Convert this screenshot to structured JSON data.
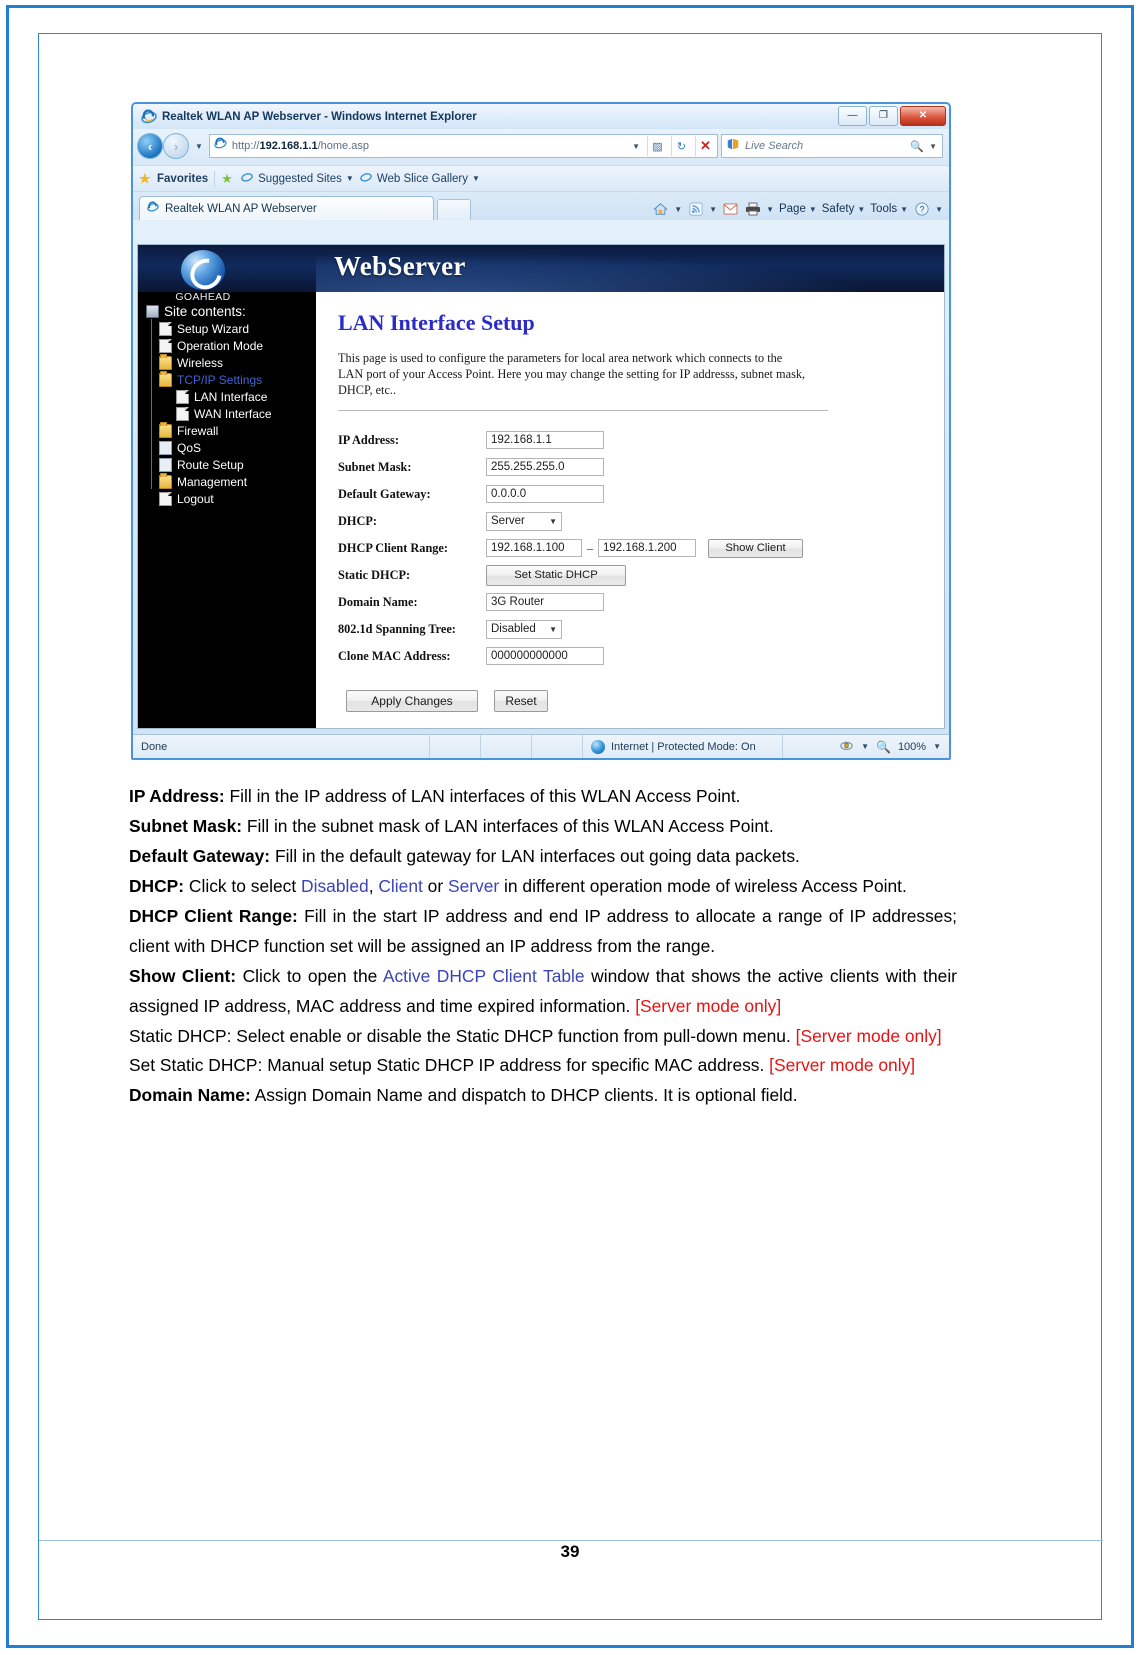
{
  "browser": {
    "title": "Realtek WLAN AP Webserver - Windows Internet Explorer",
    "window_buttons": {
      "minimize": "—",
      "maximize": "❐",
      "close": "✕"
    },
    "address": {
      "protocol": "http://",
      "host": "192.168.1.1",
      "path": "/home.asp"
    },
    "search": {
      "placeholder": "Live Search",
      "value": "Live Search"
    },
    "favorites_bar": {
      "favorites": "Favorites",
      "suggested_sites": "Suggested Sites",
      "web_slice_gallery": "Web Slice Gallery"
    },
    "tab": {
      "label": "Realtek WLAN AP Webserver"
    },
    "command_bar": {
      "page": "Page",
      "safety": "Safety",
      "tools": "Tools"
    },
    "status": {
      "done": "Done",
      "zone": "Internet | Protected Mode: On",
      "zoom": "100%"
    }
  },
  "webserver": {
    "brand": {
      "name": "GOAHEAD",
      "title": "WebServer"
    },
    "tree": {
      "root": "Site contents:",
      "items": [
        {
          "label": "Setup Wizard",
          "icon": "doc",
          "level": 1,
          "active": false
        },
        {
          "label": "Operation Mode",
          "icon": "doc",
          "level": 1,
          "active": false
        },
        {
          "label": "Wireless",
          "icon": "folder",
          "level": 1,
          "active": false
        },
        {
          "label": "TCP/IP Settings",
          "icon": "folder-open",
          "level": 1,
          "active": true
        },
        {
          "label": "LAN Interface",
          "icon": "doc",
          "level": 2,
          "active": false
        },
        {
          "label": "WAN Interface",
          "icon": "doc",
          "level": 2,
          "active": false
        },
        {
          "label": "Firewall",
          "icon": "folder",
          "level": 1,
          "active": false
        },
        {
          "label": "QoS",
          "icon": "book",
          "level": 1,
          "active": false
        },
        {
          "label": "Route Setup",
          "icon": "book",
          "level": 1,
          "active": false
        },
        {
          "label": "Management",
          "icon": "folder",
          "level": 1,
          "active": false
        },
        {
          "label": "Logout",
          "icon": "doc",
          "level": 1,
          "active": false
        }
      ]
    },
    "page": {
      "title": "LAN Interface Setup",
      "description": "This page is used to configure the parameters for local area network which connects to the LAN port of your Access Point. Here you may change the setting for IP addresss, subnet mask, DHCP, etc..",
      "fields": {
        "ip_address_label": "IP Address:",
        "ip_address_value": "192.168.1.1",
        "subnet_mask_label": "Subnet Mask:",
        "subnet_mask_value": "255.255.255.0",
        "default_gateway_label": "Default Gateway:",
        "default_gateway_value": "0.0.0.0",
        "dhcp_label": "DHCP:",
        "dhcp_value": "Server",
        "dhcp_range_label": "DHCP Client Range:",
        "dhcp_range_start": "192.168.1.100",
        "dhcp_range_sep": "–",
        "dhcp_range_end": "192.168.1.200",
        "show_client_button": "Show Client",
        "static_dhcp_label": "Static DHCP:",
        "set_static_dhcp_button": "Set Static DHCP",
        "domain_name_label": "Domain Name:",
        "domain_name_value": "3G Router",
        "spanning_tree_label": "802.1d Spanning Tree:",
        "spanning_tree_value": "Disabled",
        "clone_mac_label": "Clone MAC Address:",
        "clone_mac_value": "000000000000"
      },
      "buttons": {
        "apply": "Apply Changes",
        "reset": "Reset"
      }
    }
  },
  "manual": {
    "paragraphs": [
      {
        "term": "IP Address:",
        "text": " Fill in the IP address of LAN interfaces of this WLAN Access Point."
      },
      {
        "term": "Subnet Mask:",
        "text": " Fill in the subnet mask of LAN interfaces of this WLAN Access Point."
      },
      {
        "term": "Default Gateway:",
        "text": " Fill in the default gateway for LAN interfaces out going data packets."
      },
      {
        "term": "DHCP:",
        "text": " Click to select Disabled, Client or Server in different operation mode of wireless Access Point."
      },
      {
        "term": "DHCP Client Range:",
        "text": " Fill in the start IP address and end IP address to allocate a range of IP addresses; client with DHCP function set will be assigned an IP address from the range."
      },
      {
        "term": "Show Client:",
        "text": " Click to open the Active DHCP Client Table window that shows the active clients with their assigned IP address, MAC address and time expired information. [Server mode only]"
      },
      {
        "term": "",
        "text": "Static DHCP: Select enable or disable the Static DHCP function from pull-down menu. [Server mode only]"
      },
      {
        "term": "",
        "text": "Set Static DHCP: Manual setup Static DHCP IP address for specific MAC address. [Server mode only]"
      },
      {
        "term": "Domain Name:",
        "text": " Assign Domain Name and dispatch to DHCP clients. It is optional field."
      }
    ],
    "inline": {
      "disabled": "Disabled",
      "client": "Client",
      "server": "Server",
      "active_dhcp_client_table": "Active DHCP Client Table",
      "server_mode_only": "[Server mode only]"
    },
    "page_number": "39"
  }
}
